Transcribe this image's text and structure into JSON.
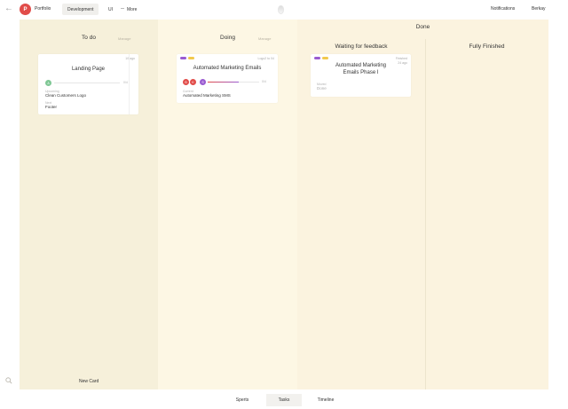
{
  "header": {
    "project_initial": "P",
    "project_name": "Portfolio",
    "tabs": [
      {
        "label": "Development",
        "active": true
      },
      {
        "label": "UI",
        "active": false
      },
      {
        "label": "More",
        "active": false
      }
    ],
    "notifications": "Notifications",
    "user": "Berkay"
  },
  "columns": {
    "todo": {
      "title": "To do",
      "manage": "Manage",
      "card": {
        "time": "10 ago",
        "title": "Landing Page",
        "assignee_initial": "A",
        "progress_label": "0/4",
        "progress": 0,
        "section_label": "Upcoming",
        "item1": "Clean Customers Logo",
        "section_label2": "Next",
        "item2": "Footer"
      },
      "new_card": "New Card"
    },
    "doing": {
      "title": "Doing",
      "manage": "Manage",
      "card": {
        "time": "Logo2 to 04",
        "title": "Automated Marketing Emails",
        "assignees": [
          "B",
          "K",
          "S"
        ],
        "progress_label": "0/4",
        "progress": 0.6,
        "section_label": "Current",
        "item1": "Automated Marketing SMS"
      }
    },
    "done": {
      "title": "Done",
      "waiting": {
        "title": "Waiting for feedback",
        "card": {
          "time_line1": "Finished",
          "time_line2": "24 ago",
          "title": "Automated Marketing Emails Phase I",
          "section_label": "Moved",
          "status": "Done"
        }
      },
      "finished": {
        "title": "Fully Finished"
      }
    }
  },
  "bottom_nav": [
    {
      "label": "Sperts",
      "active": false
    },
    {
      "label": "Tasks",
      "active": true
    },
    {
      "label": "Timeline",
      "active": false
    }
  ],
  "colors": {
    "accent_red": "#e14c49",
    "accent_purple": "#9a5bd1",
    "accent_yellow": "#f2c94c",
    "accent_green": "#7fc795"
  }
}
